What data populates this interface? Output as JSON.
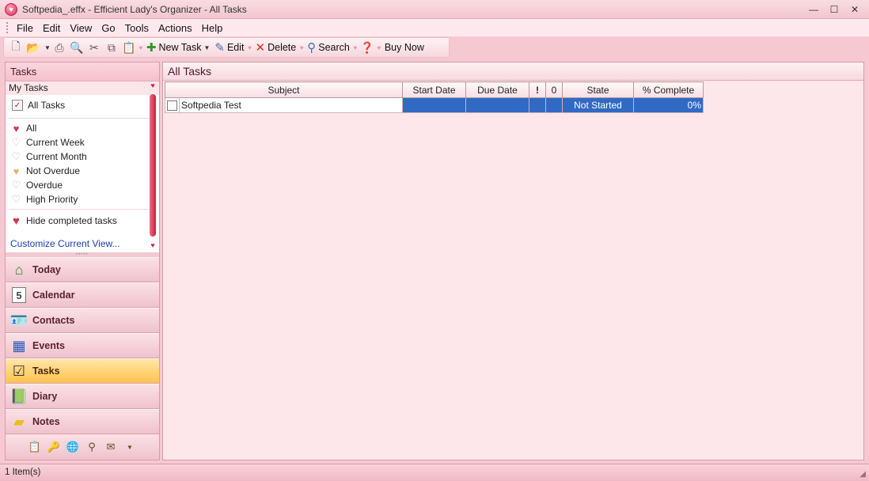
{
  "window": {
    "title": "Softpedia_.effx - Efficient Lady's Organizer - All Tasks",
    "minimize": "—",
    "maximize": "☐",
    "close": "✕"
  },
  "menu": [
    "File",
    "Edit",
    "View",
    "Go",
    "Tools",
    "Actions",
    "Help"
  ],
  "toolbar": {
    "new_task": "New Task",
    "edit": "Edit",
    "delete": "Delete",
    "search": "Search",
    "buy_now": "Buy Now"
  },
  "left_pane": {
    "title": "Tasks",
    "group": "My Tasks",
    "all_tasks": "All Tasks",
    "views": [
      "All",
      "Current Week",
      "Current Month",
      "Not Overdue",
      "Overdue",
      "High Priority"
    ],
    "hide_completed": "Hide completed tasks",
    "customize": "Customize Current View...",
    "nav": [
      "Today",
      "Calendar",
      "Contacts",
      "Events",
      "Tasks",
      "Diary",
      "Notes"
    ],
    "active_nav": "Tasks"
  },
  "main": {
    "title": "All Tasks",
    "columns": [
      "Subject",
      "Start Date",
      "Due Date",
      "!",
      "0",
      "State",
      "% Complete"
    ],
    "rows": [
      {
        "subject": "Softpedia Test",
        "start": "",
        "due": "",
        "priority": "",
        "attach": "",
        "state": "Not Started",
        "complete": "0%"
      }
    ]
  },
  "status": "1 Item(s)",
  "colors": {
    "accent": "#e8304f",
    "selection": "#316ac5",
    "active_nav": "#ffc24d"
  }
}
